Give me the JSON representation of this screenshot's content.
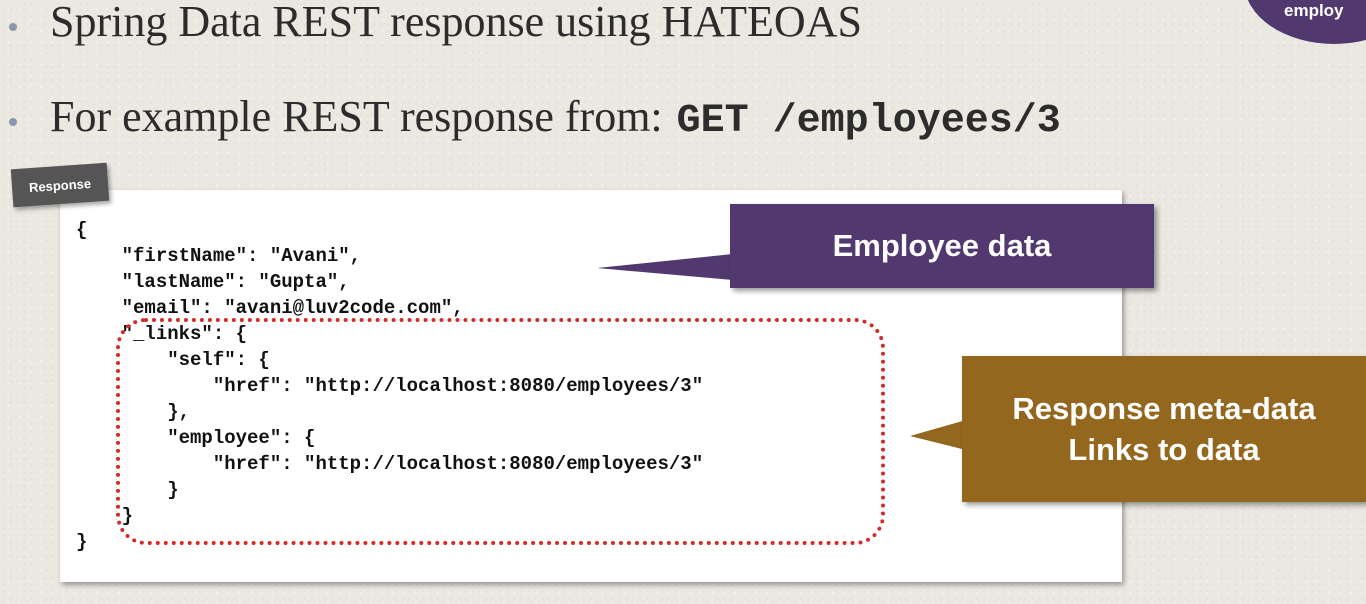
{
  "bullets": {
    "first": "Spring Data REST response using HATEOAS",
    "second_prefix": "For example REST response from:",
    "second_code": "GET /employees/3"
  },
  "corner_badge": {
    "label": "employ"
  },
  "response_tag": "Response",
  "code_lines": [
    "{",
    "    \"firstName\": \"Avani\",",
    "    \"lastName\": \"Gupta\",",
    "    \"email\": \"avani@luv2code.com\",",
    "    \"_links\": {",
    "        \"self\": {",
    "            \"href\": \"http://localhost:8080/employees/3\"",
    "        },",
    "        \"employee\": {",
    "            \"href\": \"http://localhost:8080/employees/3\"",
    "        }",
    "    }",
    "}"
  ],
  "callouts": {
    "employee_data": "Employee data",
    "meta_line1": "Response meta-data",
    "meta_line2": "Links to data"
  },
  "colors": {
    "purple": "#51386e",
    "gold": "#94671f",
    "dotted_red": "#d42a2a",
    "bullet_dot": "#8a97ad"
  }
}
